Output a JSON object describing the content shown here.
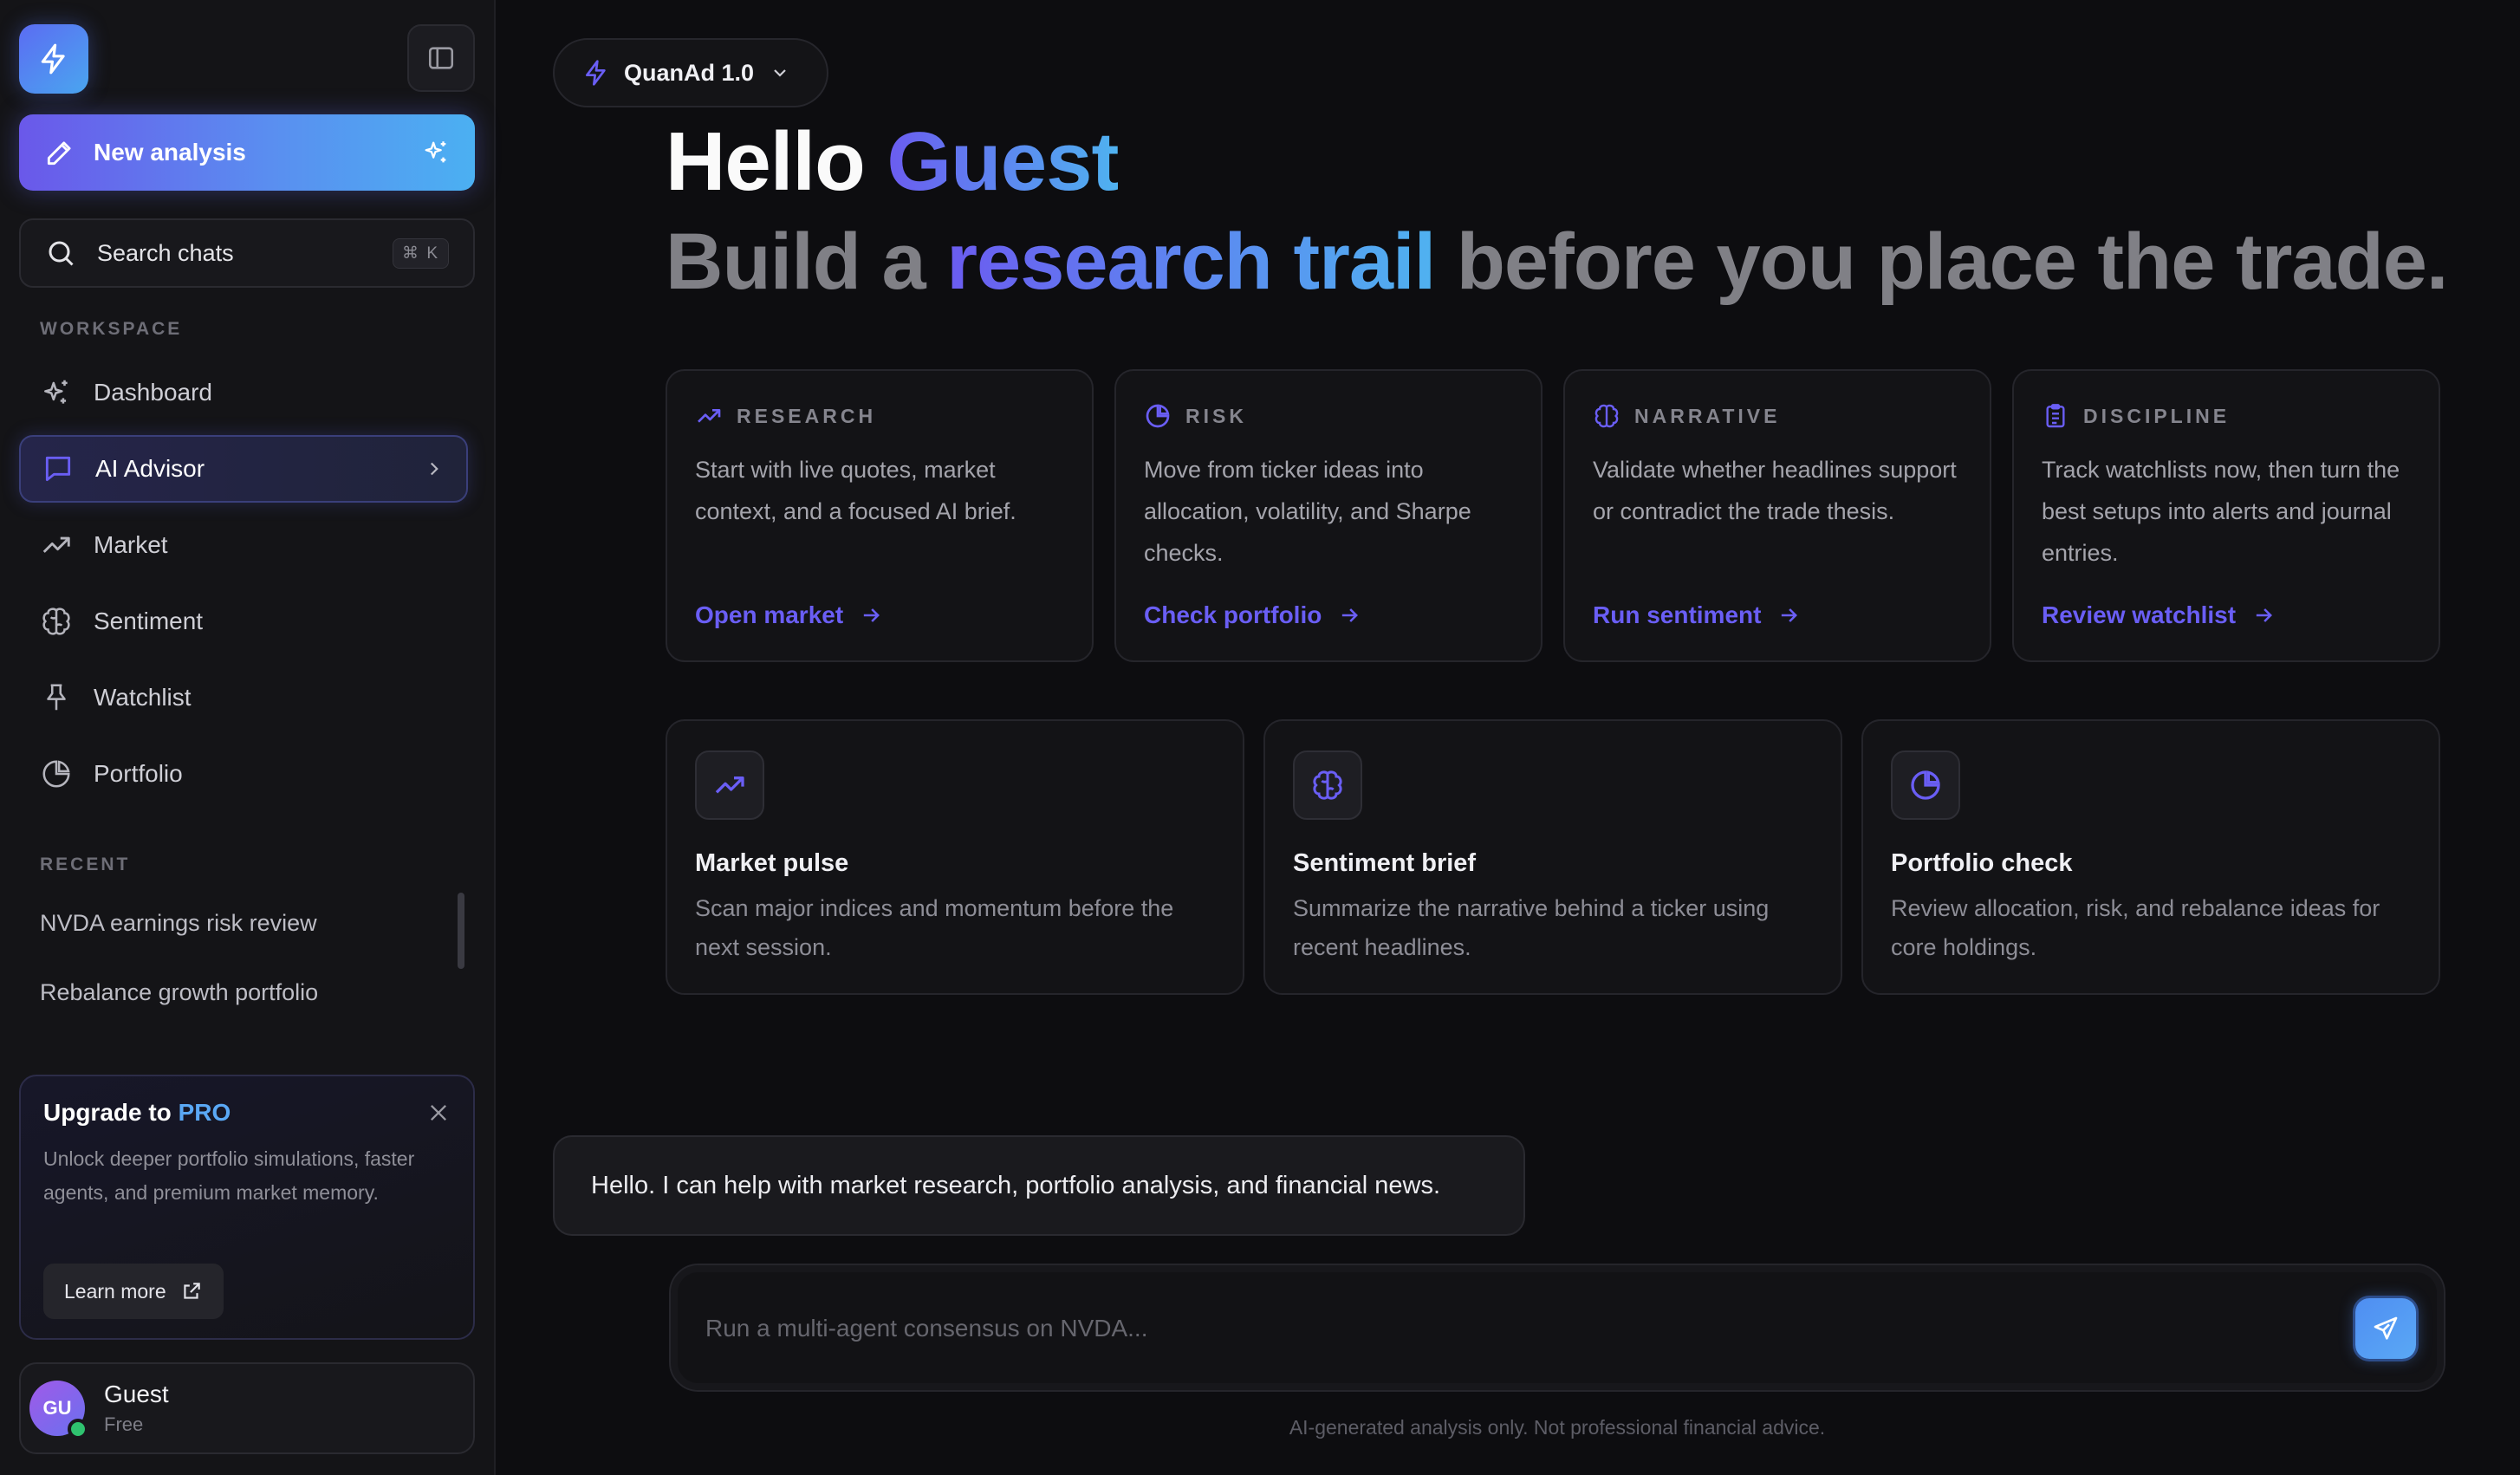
{
  "colors": {
    "accent_purple": "#6a5ef5",
    "accent_blue": "#4fb2f0",
    "background": "#0d0d10",
    "sidebar_bg": "#141417",
    "online": "#2fc26f"
  },
  "sidebar": {
    "logo_icon": "lightning-bolt-icon",
    "collapse_icon": "sidebar-toggle-icon",
    "new_analysis": {
      "label": "New analysis",
      "icon": "pencil-icon",
      "trailing_icon": "sparkles-icon"
    },
    "search": {
      "label": "Search chats",
      "shortcut": "⌘ K",
      "icon": "search-icon"
    },
    "workspace_label": "WORKSPACE",
    "items": [
      {
        "label": "Dashboard",
        "icon": "sparkles-icon",
        "active": false
      },
      {
        "label": "AI Advisor",
        "icon": "chat-bubble-icon",
        "active": true
      },
      {
        "label": "Market",
        "icon": "trend-up-icon",
        "active": false
      },
      {
        "label": "Sentiment",
        "icon": "brain-icon",
        "active": false
      },
      {
        "label": "Watchlist",
        "icon": "pin-icon",
        "active": false
      },
      {
        "label": "Portfolio",
        "icon": "pie-chart-icon",
        "active": false
      }
    ],
    "recent_label": "RECENT",
    "recent": [
      "NVDA earnings risk review",
      "Rebalance growth portfolio"
    ],
    "upgrade": {
      "title": "Upgrade to",
      "title_highlight": "PRO",
      "description": "Unlock deeper portfolio simulations, faster agents, and premium market memory.",
      "button": "Learn more"
    },
    "user": {
      "initials": "GU",
      "name": "Guest",
      "plan": "Free"
    }
  },
  "header": {
    "model": "QuanAd 1.0"
  },
  "hero": {
    "greeting": "Hello",
    "name": "Guest",
    "tagline_start": "Build a",
    "tagline_highlight": "research trail",
    "tagline_end": "before you place the trade."
  },
  "feature_cards": [
    {
      "category": "RESEARCH",
      "icon": "trend-up-icon",
      "description": "Start with live quotes, market context, and a focused AI brief.",
      "link": "Open market"
    },
    {
      "category": "RISK",
      "icon": "pie-chart-icon",
      "description": "Move from ticker ideas into allocation, volatility, and Sharpe checks.",
      "link": "Check portfolio"
    },
    {
      "category": "NARRATIVE",
      "icon": "brain-icon",
      "description": "Validate whether headlines support or contradict the trade thesis.",
      "link": "Run sentiment"
    },
    {
      "category": "DISCIPLINE",
      "icon": "clipboard-icon",
      "description": "Track watchlists now, then turn the best setups into alerts and journal entries.",
      "link": "Review watchlist"
    }
  ],
  "quick_cards": [
    {
      "title": "Market pulse",
      "icon": "trend-up-icon",
      "description": "Scan major indices and momentum before the next session."
    },
    {
      "title": "Sentiment brief",
      "icon": "brain-icon",
      "description": "Summarize the narrative behind a ticker using recent headlines."
    },
    {
      "title": "Portfolio check",
      "icon": "pie-chart-icon",
      "description": "Review allocation, risk, and rebalance ideas for core holdings."
    }
  ],
  "chat": {
    "assistant_message": "Hello. I can help with market research, portfolio analysis, and financial news."
  },
  "composer": {
    "placeholder": "Run a multi-agent consensus on NVDA...",
    "value": "",
    "send_icon": "send-icon"
  },
  "disclaimer": "AI-generated analysis only. Not professional financial advice."
}
